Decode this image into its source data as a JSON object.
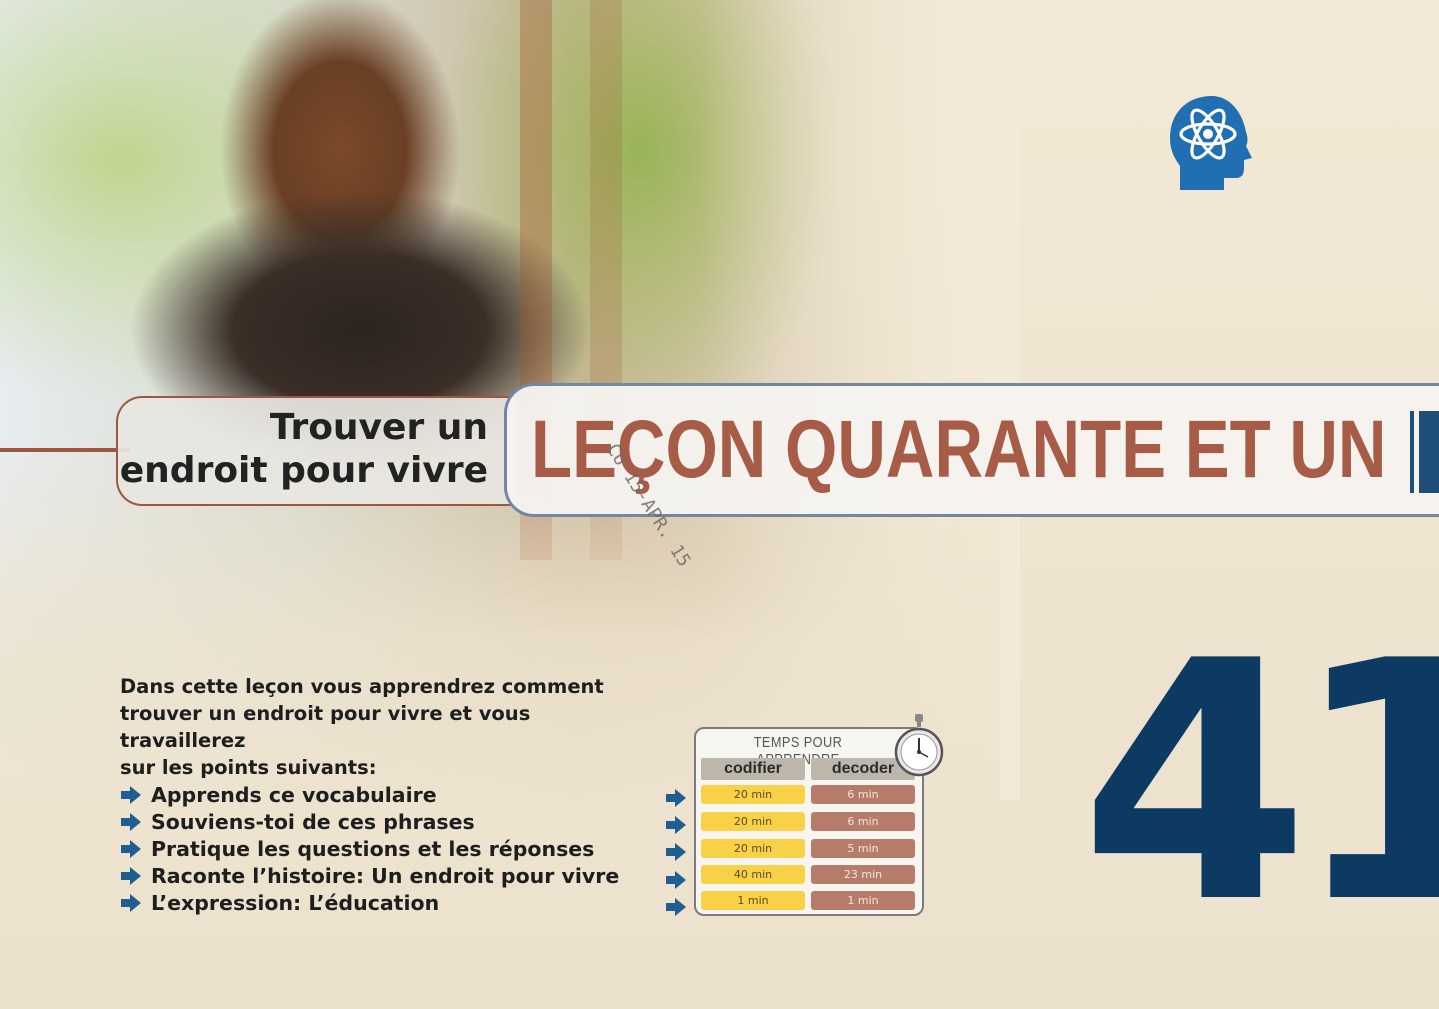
{
  "header": {
    "subtitle_line1": "Trouver un",
    "subtitle_line2": "endroit pour vivre",
    "title": "LEÇON QUARANTE ET UN"
  },
  "stamp": "CU 15-APR. 15",
  "lesson_number": "41",
  "intro": {
    "text_line1": "Dans cette leçon vous apprendrez comment",
    "text_line2": "trouver un endroit pour vivre et vous travaillerez",
    "text_line3": "sur les points suivants:"
  },
  "topics": [
    "Apprends ce vocabulaire",
    "Souviens-toi de ces phrases",
    "Pratique les questions et les réponses",
    "Raconte l’histoire: Un endroit pour vivre",
    "L’expression: L’éducation"
  ],
  "time_table": {
    "title": "TEMPS POUR APPRENDRE",
    "col_codifier": "codifier",
    "col_decoder": "decoder",
    "rows": [
      {
        "codifier": "20 min",
        "decoder": "6 min"
      },
      {
        "codifier": "20 min",
        "decoder": "6 min"
      },
      {
        "codifier": "20 min",
        "decoder": "5 min"
      },
      {
        "codifier": "40 min",
        "decoder": "23 min"
      },
      {
        "codifier": "1 min",
        "decoder": "1 min"
      }
    ]
  },
  "colors": {
    "title": "#a65c47",
    "number": "#0d3a63",
    "arrow": "#1f5e93",
    "codifier_cell": "#f8d146",
    "decoder_cell": "#b77b6a"
  },
  "icons": [
    "brain-atom-logo-icon",
    "arrow-right-icon",
    "stopwatch-icon"
  ]
}
